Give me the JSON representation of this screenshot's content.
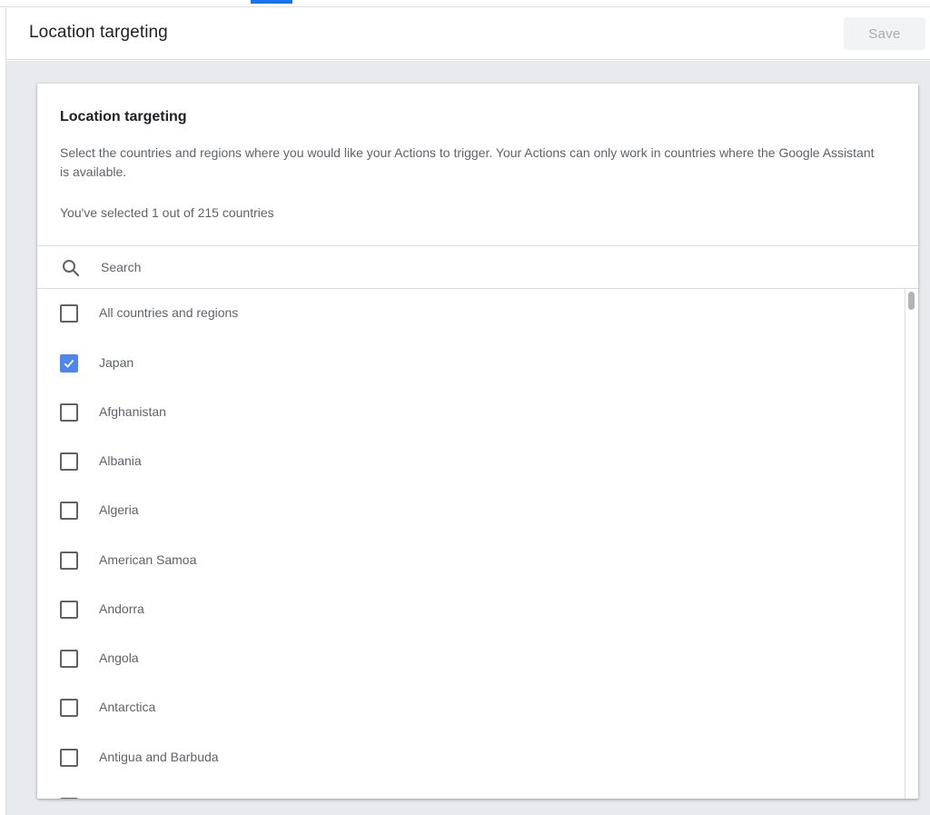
{
  "header": {
    "title": "Location targeting",
    "save_label": "Save"
  },
  "card": {
    "title": "Location targeting",
    "description": "Select the countries and regions where you would like your Actions to trigger. Your Actions can only work in countries where the Google Assistant is available.",
    "selection_count": "You've selected 1 out of 215 countries"
  },
  "search": {
    "placeholder": "Search",
    "icon": "search-icon"
  },
  "list": {
    "items": [
      {
        "label": "All countries and regions",
        "checked": false
      },
      {
        "label": "Japan",
        "checked": true
      },
      {
        "label": "Afghanistan",
        "checked": false
      },
      {
        "label": "Albania",
        "checked": false
      },
      {
        "label": "Algeria",
        "checked": false
      },
      {
        "label": "American Samoa",
        "checked": false
      },
      {
        "label": "Andorra",
        "checked": false
      },
      {
        "label": "Angola",
        "checked": false
      },
      {
        "label": "Antarctica",
        "checked": false
      },
      {
        "label": "Antigua and Barbuda",
        "checked": false
      }
    ]
  },
  "colors": {
    "accent": "#1a73e8",
    "checkbox_checked": "#4f86e8",
    "background": "#e8eaed"
  }
}
